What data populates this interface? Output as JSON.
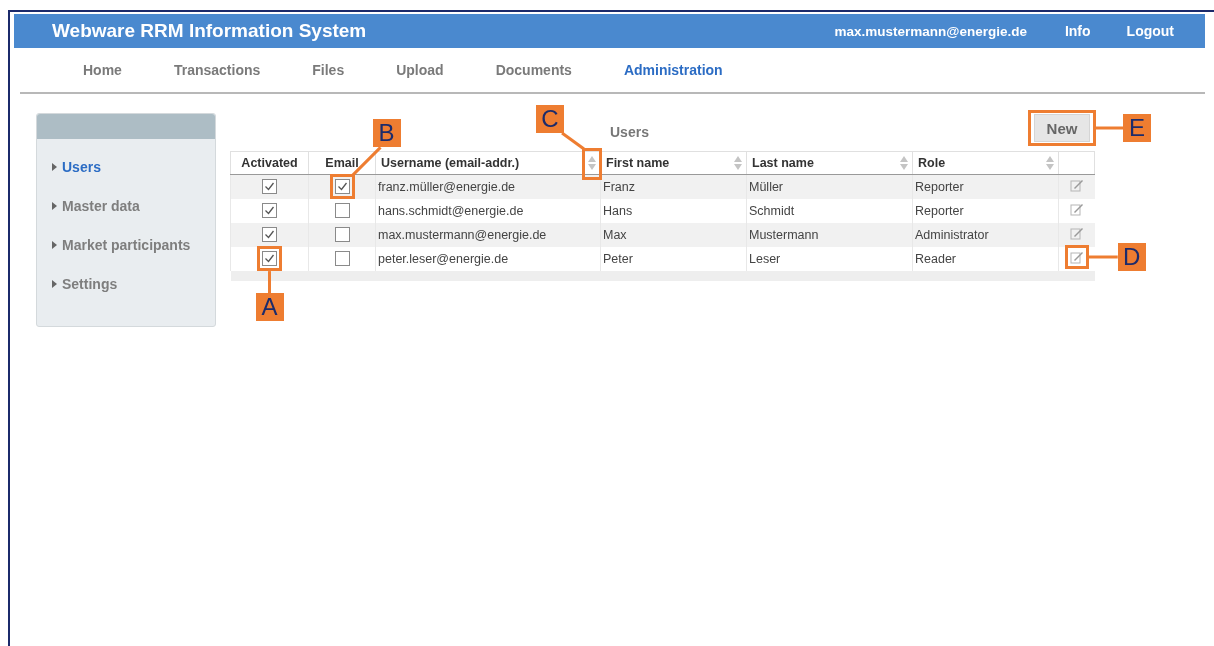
{
  "header": {
    "title": "Webware RRM Information System",
    "user": "max.mustermann@energie.de",
    "links": [
      "Info",
      "Logout"
    ]
  },
  "nav": {
    "tabs": [
      {
        "label": "Home",
        "selected": false
      },
      {
        "label": "Transactions",
        "selected": false
      },
      {
        "label": "Files",
        "selected": false
      },
      {
        "label": "Upload",
        "selected": false
      },
      {
        "label": "Documents",
        "selected": false
      },
      {
        "label": "Administration",
        "selected": true
      }
    ]
  },
  "sidebar": {
    "items": [
      {
        "label": "Users",
        "selected": true
      },
      {
        "label": "Master data",
        "selected": false
      },
      {
        "label": "Market participants",
        "selected": false
      },
      {
        "label": "Settings",
        "selected": false
      }
    ]
  },
  "users": {
    "title": "Users",
    "new_button": "New",
    "columns": [
      {
        "label": "Activated",
        "sortable": false
      },
      {
        "label": "Email",
        "sortable": false
      },
      {
        "label": "Username (email-addr.)",
        "sortable": true
      },
      {
        "label": "First name",
        "sortable": true
      },
      {
        "label": "Last name",
        "sortable": true
      },
      {
        "label": "Role",
        "sortable": true
      }
    ],
    "rows": [
      {
        "activated": true,
        "email": true,
        "username": "franz.müller@energie.de",
        "first_name": "Franz",
        "last_name": "Müller",
        "role": "Reporter"
      },
      {
        "activated": true,
        "email": false,
        "username": "hans.schmidt@energie.de",
        "first_name": "Hans",
        "last_name": "Schmidt",
        "role": "Reporter"
      },
      {
        "activated": true,
        "email": false,
        "username": "max.mustermann@energie.de",
        "first_name": "Max",
        "last_name": "Mustermann",
        "role": "Administrator"
      },
      {
        "activated": true,
        "email": false,
        "username": "peter.leser@energie.de",
        "first_name": "Peter",
        "last_name": "Leser",
        "role": "Reader"
      }
    ]
  },
  "callouts": [
    {
      "label": "A"
    },
    {
      "label": "B"
    },
    {
      "label": "C"
    },
    {
      "label": "D"
    },
    {
      "label": "E"
    }
  ]
}
